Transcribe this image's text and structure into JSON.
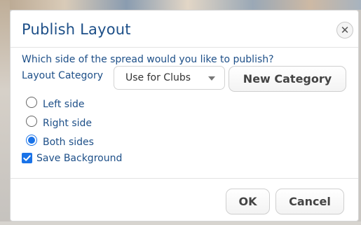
{
  "dialog": {
    "title": "Publish Layout",
    "close_icon": "close-icon",
    "question": "Which side of the spread would you like to publish?",
    "layout_category": {
      "label": "Layout Category",
      "selected": "Use for Clubs"
    },
    "new_category_label": "New Category",
    "sides": [
      {
        "label": "Left side",
        "checked": false
      },
      {
        "label": "Right side",
        "checked": false
      },
      {
        "label": "Both sides",
        "checked": true
      }
    ],
    "save_background": {
      "label": "Save Background",
      "checked": true
    },
    "ok_label": "OK",
    "cancel_label": "Cancel"
  },
  "colors": {
    "accent": "#1a73e8",
    "text": "#1d4f88"
  }
}
